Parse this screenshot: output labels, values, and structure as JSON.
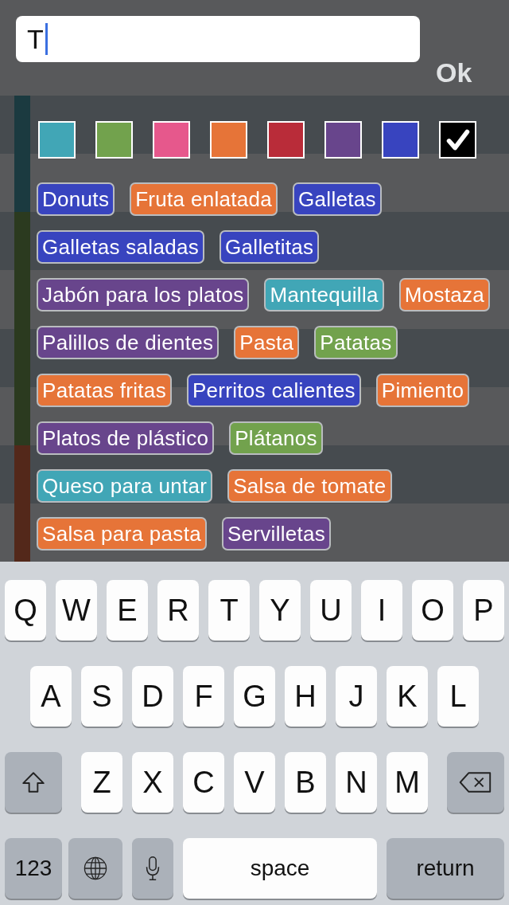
{
  "search": {
    "value": "T"
  },
  "ok_button": "Ok",
  "background_rows": [
    {
      "color": "#1b3a40"
    },
    {
      "color": "#1b3a40"
    },
    {
      "color": "#2b3a1f"
    },
    {
      "color": "#2b3a1f"
    },
    {
      "color": "#2b3a1f"
    },
    {
      "color": "#2b3a1f"
    },
    {
      "color": "#53281a"
    },
    {
      "color": "#53281a"
    }
  ],
  "swatches": [
    {
      "color": "#41a6b6",
      "selected": false
    },
    {
      "color": "#72a24d",
      "selected": false
    },
    {
      "color": "#e6588c",
      "selected": false
    },
    {
      "color": "#e67438",
      "selected": false
    },
    {
      "color": "#b92c39",
      "selected": false
    },
    {
      "color": "#68458c",
      "selected": false
    },
    {
      "color": "#3844bf",
      "selected": false
    },
    {
      "color": "#000000",
      "selected": true
    }
  ],
  "tags": [
    {
      "label": "Donuts",
      "color": "#3844bf"
    },
    {
      "label": "Fruta enlatada",
      "color": "#e67438"
    },
    {
      "label": "Galletas",
      "color": "#3844bf"
    },
    {
      "label": "Galletas saladas",
      "color": "#3844bf"
    },
    {
      "label": "Galletitas",
      "color": "#3844bf"
    },
    {
      "label": "Jabón para los platos",
      "color": "#68458c"
    },
    {
      "label": "Mantequilla",
      "color": "#41a6b6"
    },
    {
      "label": "Mostaza",
      "color": "#e67438"
    },
    {
      "label": "Palillos de dientes",
      "color": "#68458c"
    },
    {
      "label": "Pasta",
      "color": "#e67438"
    },
    {
      "label": "Patatas",
      "color": "#72a24d"
    },
    {
      "label": "Patatas fritas",
      "color": "#e67438"
    },
    {
      "label": "Perritos calientes",
      "color": "#3844bf"
    },
    {
      "label": "Pimiento",
      "color": "#e67438"
    },
    {
      "label": "Platos de plástico",
      "color": "#68458c"
    },
    {
      "label": "Plátanos",
      "color": "#72a24d"
    },
    {
      "label": "Queso para untar",
      "color": "#41a6b6"
    },
    {
      "label": "Salsa de tomate",
      "color": "#e67438"
    },
    {
      "label": "Salsa para pasta",
      "color": "#e67438"
    },
    {
      "label": "Servilletas",
      "color": "#68458c"
    }
  ],
  "keyboard": {
    "rows": [
      [
        {
          "kind": "letter",
          "label": "Q"
        },
        {
          "kind": "letter",
          "label": "W"
        },
        {
          "kind": "letter",
          "label": "E"
        },
        {
          "kind": "letter",
          "label": "R"
        },
        {
          "kind": "letter",
          "label": "T"
        },
        {
          "kind": "letter",
          "label": "Y"
        },
        {
          "kind": "letter",
          "label": "U"
        },
        {
          "kind": "letter",
          "label": "I"
        },
        {
          "kind": "letter",
          "label": "O"
        },
        {
          "kind": "letter",
          "label": "P"
        }
      ],
      [
        {
          "kind": "letter",
          "label": "A"
        },
        {
          "kind": "letter",
          "label": "S"
        },
        {
          "kind": "letter",
          "label": "D"
        },
        {
          "kind": "letter",
          "label": "F"
        },
        {
          "kind": "letter",
          "label": "G"
        },
        {
          "kind": "letter",
          "label": "H"
        },
        {
          "kind": "letter",
          "label": "J"
        },
        {
          "kind": "letter",
          "label": "K"
        },
        {
          "kind": "letter",
          "label": "L"
        }
      ],
      [
        {
          "kind": "shift"
        },
        {
          "kind": "letter",
          "label": "Z"
        },
        {
          "kind": "letter",
          "label": "X"
        },
        {
          "kind": "letter",
          "label": "C"
        },
        {
          "kind": "letter",
          "label": "V"
        },
        {
          "kind": "letter",
          "label": "B"
        },
        {
          "kind": "letter",
          "label": "N"
        },
        {
          "kind": "letter",
          "label": "M"
        },
        {
          "kind": "backspace"
        }
      ]
    ],
    "bottom_bar": [
      {
        "kind": "numbers",
        "label": "123"
      },
      {
        "kind": "globe"
      },
      {
        "kind": "mic"
      },
      {
        "kind": "space",
        "label": "space"
      },
      {
        "kind": "return",
        "label": "return"
      }
    ]
  }
}
